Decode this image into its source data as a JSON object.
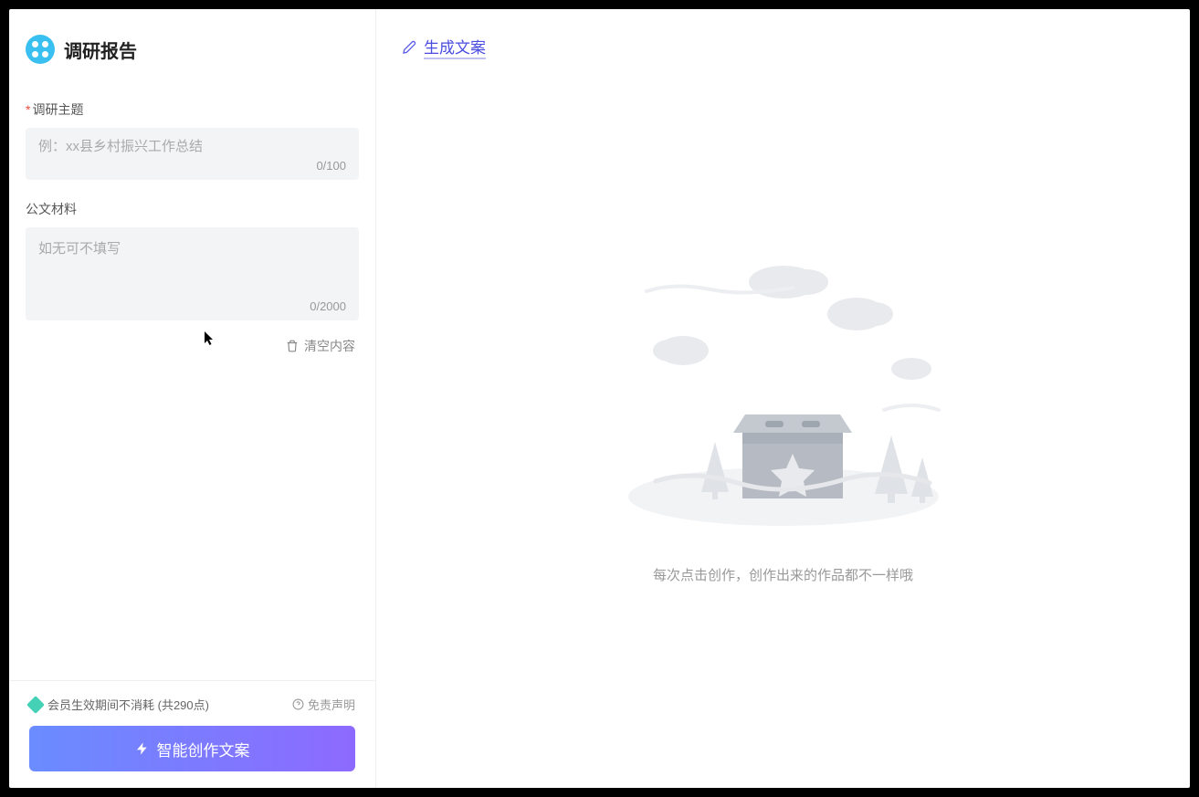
{
  "header": {
    "title": "调研报告"
  },
  "form": {
    "topic": {
      "label": "调研主题",
      "placeholder": "例：xx县乡村振兴工作总结",
      "counter": "0/100",
      "required": true
    },
    "material": {
      "label": "公文材料",
      "placeholder": "如无可不填写",
      "counter": "0/2000"
    },
    "clear_label": "清空内容"
  },
  "footer": {
    "membership_text": "会员生效期间不消耗 (共290点)",
    "disclaimer": "免责声明",
    "generate_button": "智能创作文案"
  },
  "main": {
    "header_title": "生成文案",
    "empty_text": "每次点击创作，创作出来的作品都不一样哦"
  }
}
